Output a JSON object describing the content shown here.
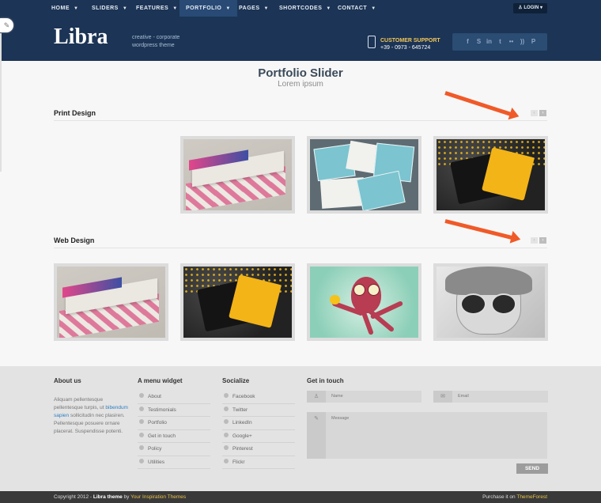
{
  "nav": {
    "items": [
      {
        "label": "HOME"
      },
      {
        "label": "SLIDERS"
      },
      {
        "label": "FEATURES"
      },
      {
        "label": "PORTFOLIO"
      },
      {
        "label": "PAGES"
      },
      {
        "label": "SHORTCODES"
      },
      {
        "label": "CONTACT"
      }
    ],
    "login_label": "LOGIN"
  },
  "header": {
    "logo": "Libra",
    "tagline_1": "creative - corporate",
    "tagline_2": "wordpress theme",
    "support_label": "CUSTOMER SUPPORT",
    "support_phone": "+39 - 0973 - 645724",
    "social_icons": [
      "facebook-icon",
      "skype-icon",
      "linkedin-icon",
      "twitter-icon",
      "flickr-icon",
      "rss-icon",
      "pinterest-icon"
    ]
  },
  "main": {
    "title": "Portfolio Slider",
    "subtitle": "Lorem ipsum",
    "sections": [
      {
        "title": "Print Design"
      },
      {
        "title": "Web Design"
      }
    ],
    "prev_glyph": "‹",
    "next_glyph": "›"
  },
  "footer": {
    "about": {
      "title": "About us",
      "text_1": "Aliquam pellentesque pellentesque turpis, ut",
      "link": "bibendum sapien",
      "text_2": "sollicitudin nec plasiren. Pellentesque posuere ornare placerat. Suspendisse potenti."
    },
    "menu": {
      "title": "A menu widget",
      "items": [
        "About",
        "Testimonials",
        "Portfolio",
        "Get in touch",
        "Policy",
        "Utilities"
      ]
    },
    "socialize": {
      "title": "Socialize",
      "items": [
        "Facebook",
        "Twitter",
        "LinkedIn",
        "Google+",
        "Pinterest",
        "Flickr"
      ]
    },
    "contact": {
      "title": "Get in touch",
      "name_placeholder": "Name",
      "email_placeholder": "Email",
      "message_placeholder": "Message",
      "send_label": "SEND"
    }
  },
  "bottom": {
    "copyright_prefix": "Copyright 2012 - ",
    "theme_name": "Libra theme",
    "by": " by ",
    "author": "Your Inspiration Themes",
    "purchase_prefix": "Purchase it on ",
    "store": "ThemeForest"
  },
  "colors": {
    "nav_bg": "#1c3455",
    "accent_arrow": "#f05a28",
    "footer_bg": "#e3e3e3"
  }
}
